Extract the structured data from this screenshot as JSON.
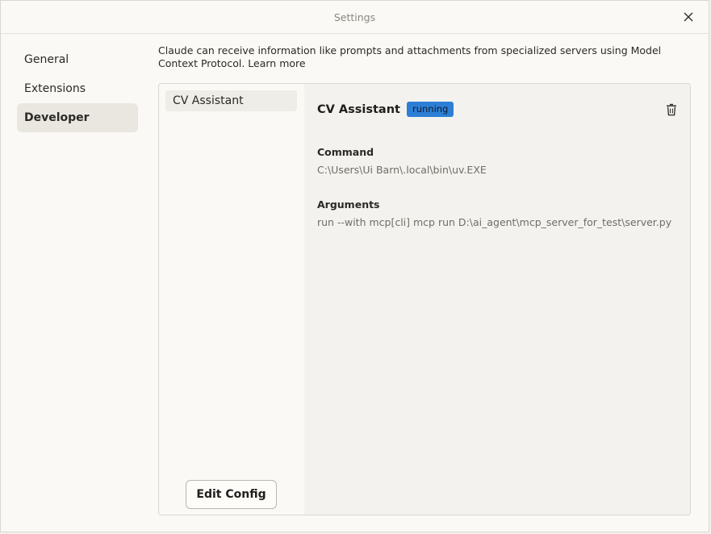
{
  "window": {
    "title": "Settings"
  },
  "sidebar": {
    "items": [
      {
        "label": "General",
        "active": false
      },
      {
        "label": "Extensions",
        "active": false
      },
      {
        "label": "Developer",
        "active": true
      }
    ]
  },
  "description": {
    "text": "Claude can receive information like prompts and attachments from specialized servers using Model Context Protocol.",
    "link": "Learn more"
  },
  "servers": {
    "items": [
      {
        "label": "CV Assistant"
      }
    ],
    "edit_config_label": "Edit Config"
  },
  "detail": {
    "name": "CV Assistant",
    "status": "running",
    "status_color": "#2d7fd6",
    "command_label": "Command",
    "command_value": "C:\\Users\\Ui Barn\\.local\\bin\\uv.EXE",
    "arguments_label": "Arguments",
    "arguments_value": "run --with mcp[cli] mcp run D:\\ai_agent\\mcp_server_for_test\\server.py",
    "delete_icon": "trash-icon"
  }
}
